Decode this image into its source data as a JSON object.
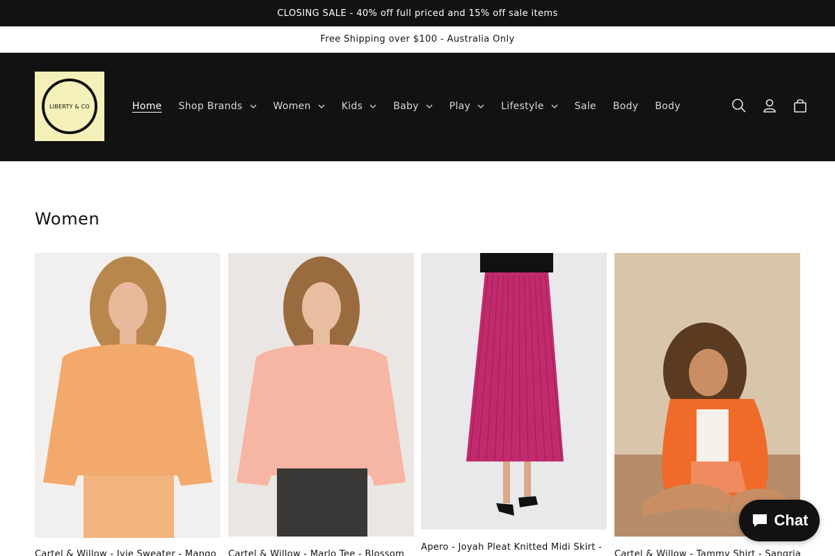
{
  "announcement": {
    "top": "CLOSING SALE - 40% off full priced and 15% off sale items",
    "second": "Free Shipping over $100 - Australia Only"
  },
  "logo": {
    "text": "LIBERTY & CO"
  },
  "nav": [
    {
      "label": "Home",
      "dropdown": false,
      "active": true
    },
    {
      "label": "Shop Brands",
      "dropdown": true
    },
    {
      "label": "Women",
      "dropdown": true
    },
    {
      "label": "Kids",
      "dropdown": true
    },
    {
      "label": "Baby",
      "dropdown": true
    },
    {
      "label": "Play",
      "dropdown": true
    },
    {
      "label": "Lifestyle",
      "dropdown": true
    },
    {
      "label": "Sale",
      "dropdown": false
    },
    {
      "label": "Body",
      "dropdown": false
    },
    {
      "label": "Body",
      "dropdown": false
    }
  ],
  "header_icons": [
    "search-icon",
    "account-icon",
    "cart-icon"
  ],
  "section": {
    "title": "Women"
  },
  "products": [
    {
      "title": "Cartel & Willow - Ivie Sweater - Mango",
      "bg": "#f2f0ee",
      "garment": "#f3a96c",
      "skin": "#e8b99a",
      "hair": "#b8874e"
    },
    {
      "title": "Cartel & Willow - Marlo Tee - Blossom",
      "bg": "#e9e6e3",
      "garment": "#f6b6a3",
      "skin": "#e7bfa0",
      "hair": "#9a6b3e"
    },
    {
      "title": "Apero - Joyah Pleat Knitted Midi Skirt -",
      "bg": "#e9e9eb",
      "garment": "#c22a6e",
      "skin": "#d8a988",
      "hair": "#111111"
    },
    {
      "title": "Cartel & Willow - Tammy Shirt - Sangria",
      "bg": "#d9c5ab",
      "garment": "#f06a2a",
      "skin": "#c98e63",
      "hair": "#5b3a22"
    }
  ],
  "chat": {
    "label": "Chat"
  },
  "colors": {
    "dark": "#121212",
    "logo_bg": "#f3f1b9"
  }
}
